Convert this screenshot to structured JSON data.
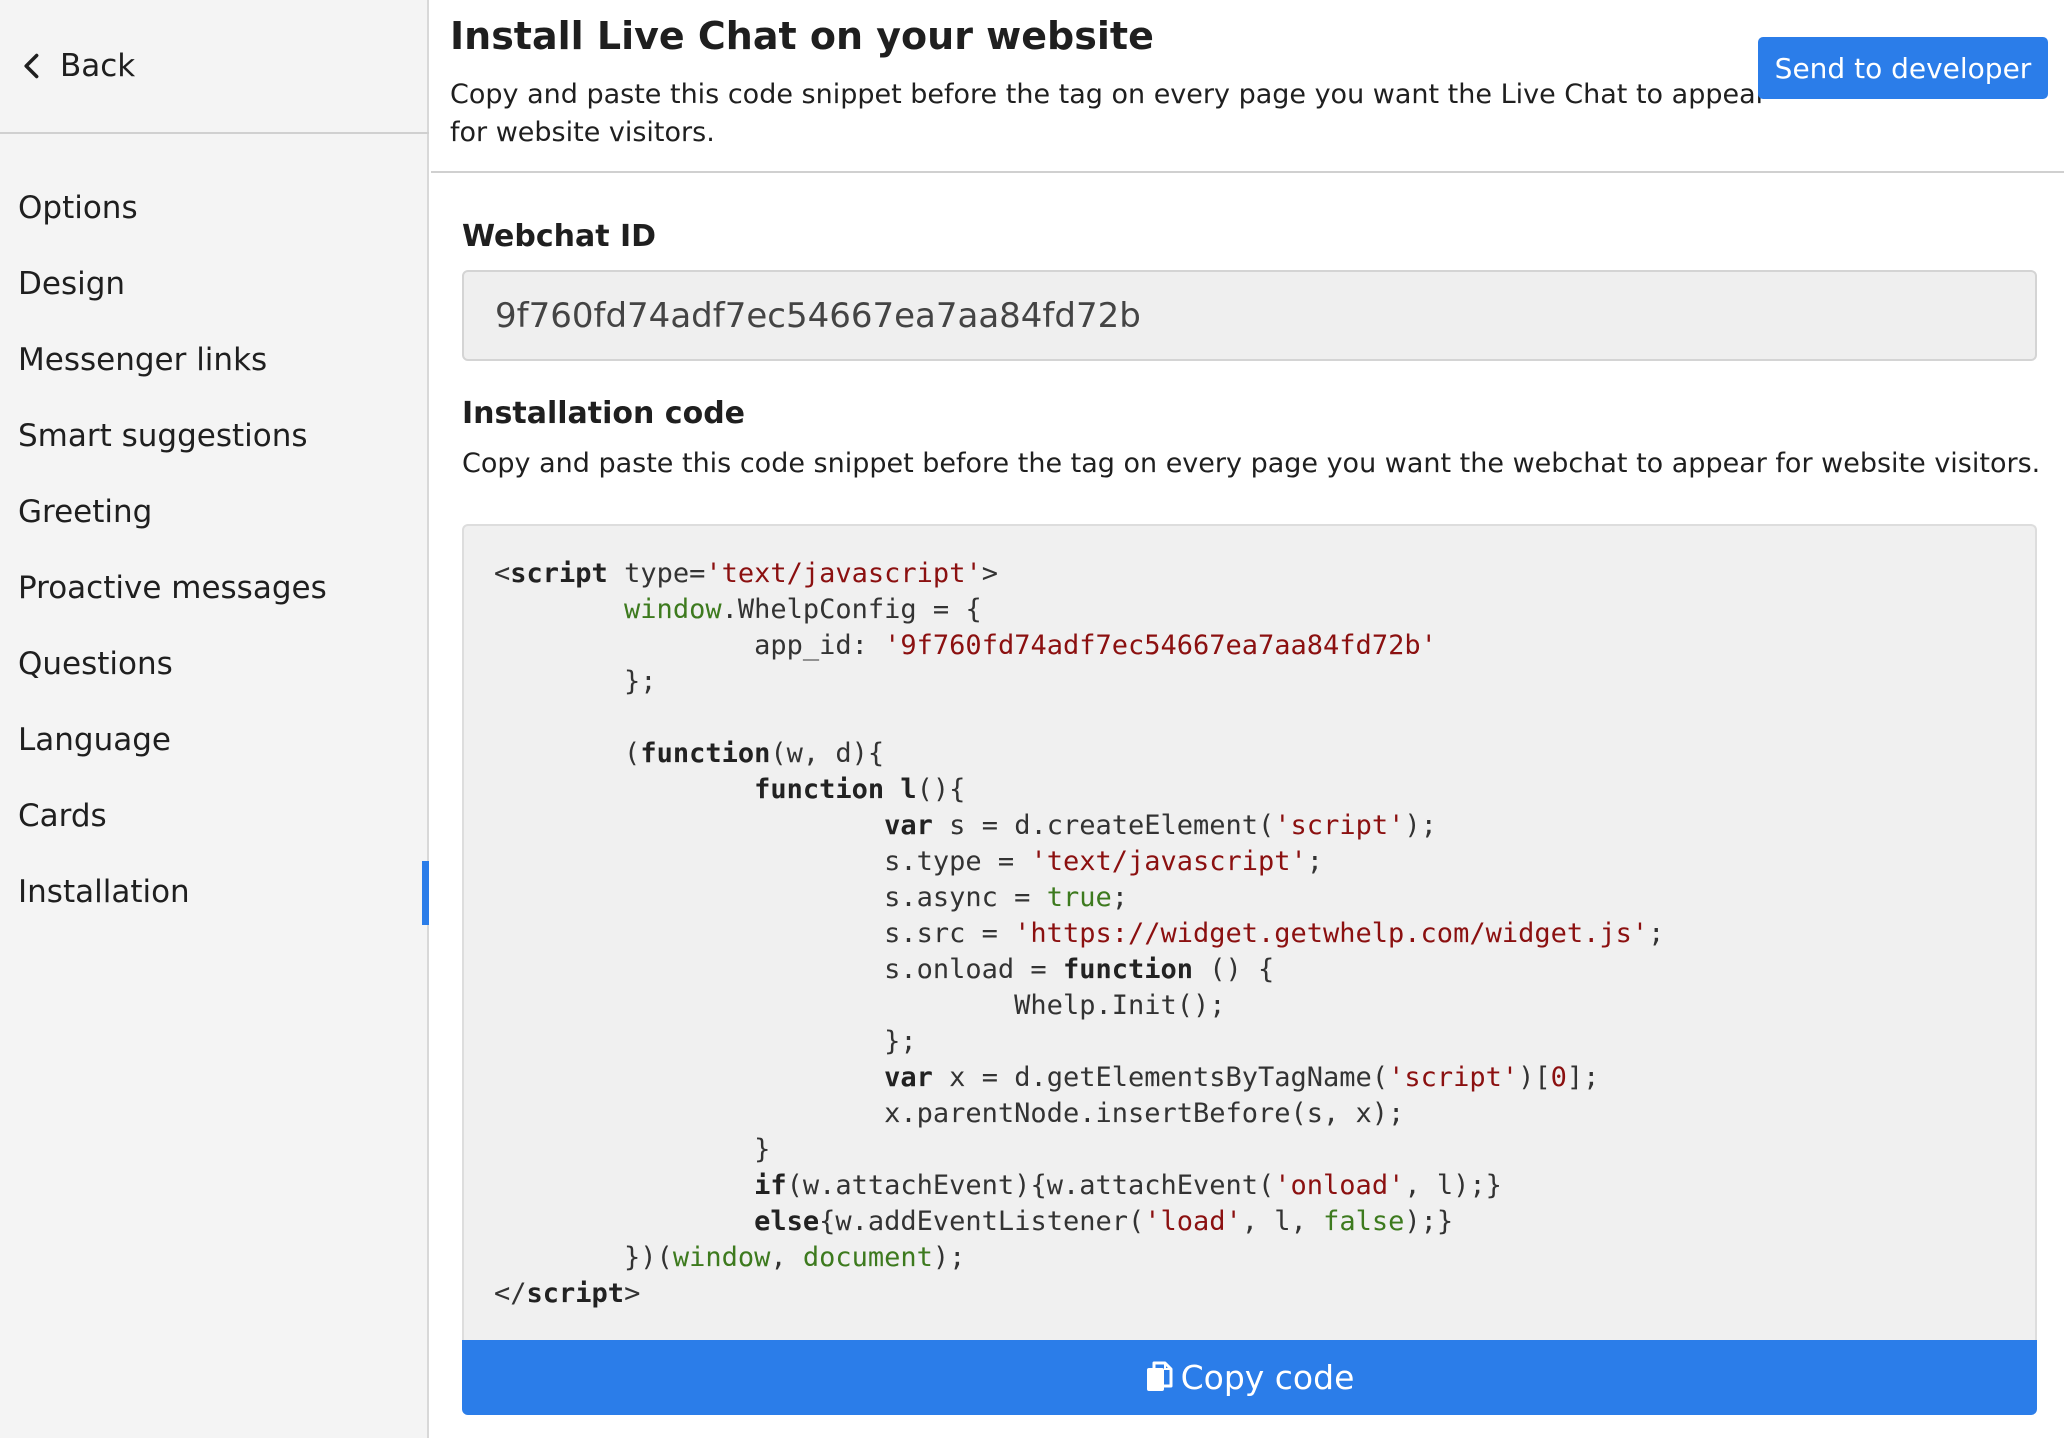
{
  "sidebar": {
    "back_label": "Back",
    "items": [
      {
        "label": "Options"
      },
      {
        "label": "Design"
      },
      {
        "label": "Messenger links"
      },
      {
        "label": "Smart suggestions"
      },
      {
        "label": "Greeting"
      },
      {
        "label": "Proactive messages"
      },
      {
        "label": "Questions"
      },
      {
        "label": "Language"
      },
      {
        "label": "Cards"
      },
      {
        "label": "Installation",
        "active": true
      }
    ]
  },
  "header": {
    "title": "Install Live Chat on your website",
    "description": "Copy and paste this code snippet before the tag on every page you want the Live Chat to appear for website visitors.",
    "send_button_label": "Send to developer"
  },
  "webchat": {
    "label": "Webchat ID",
    "value": "9f760fd74adf7ec54667ea7aa84fd72b"
  },
  "installation": {
    "label": "Installation code",
    "description": "Copy and paste this code snippet before the tag on every page you want the webchat to appear for website visitors.",
    "code": {
      "type_attr": "'text/javascript'",
      "config_name": "WhelpConfig",
      "app_id_key": "app_id",
      "app_id_value": "'9f760fd74adf7ec54667ea7aa84fd72b'",
      "script_str": "'script'",
      "type_str": "'text/javascript'",
      "src_str": "'https://widget.getwhelp.com/widget.js'",
      "init_call": "Whelp.Init();",
      "onload_str": "'onload'",
      "load_str": "'load'"
    },
    "copy_button_label": "Copy code"
  },
  "colors": {
    "accent": "#2b7de9",
    "code_string": "#8b1010",
    "code_global": "#3d7a1e",
    "sidebar_bg": "#f4f4f4"
  },
  "icons": {
    "back": "chevron-left-icon",
    "copy": "copy-icon"
  }
}
